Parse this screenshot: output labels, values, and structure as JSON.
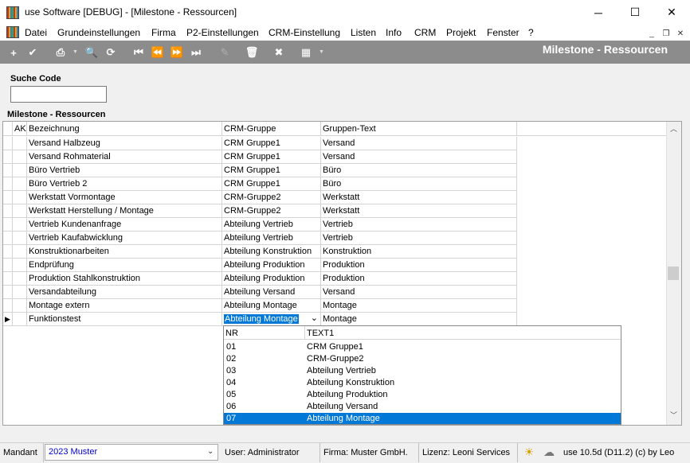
{
  "window": {
    "title": "use Software [DEBUG] - [Milestone - Ressourcen]",
    "min_glyph": "─",
    "max_glyph": "☐",
    "close_glyph": "✕"
  },
  "menu": {
    "items": [
      "Datei",
      "Grundeinstellungen",
      "Firma",
      "P2-Einstellungen",
      "CRM-Einstellung",
      "Listen",
      "Info",
      "CRM",
      "Projekt",
      "Fenster",
      "?"
    ],
    "mdi_min": "_",
    "mdi_restore": "❐",
    "mdi_close": "✕"
  },
  "toolbar": {
    "screen_title": "Milestone - Ressourcen",
    "buttons": [
      {
        "name": "add-icon",
        "glyph": "+"
      },
      {
        "name": "checkmark-icon",
        "glyph": "✔"
      },
      {
        "name": "print-icon",
        "glyph": "⎙"
      },
      {
        "name": "search-icon",
        "glyph": "🔍"
      },
      {
        "name": "refresh-icon",
        "glyph": "⟳"
      },
      {
        "name": "first-record-icon",
        "glyph": "⏮"
      },
      {
        "name": "previous-record-icon",
        "glyph": "⏪"
      },
      {
        "name": "next-record-icon",
        "glyph": "⏩"
      },
      {
        "name": "last-record-icon",
        "glyph": "⏭"
      },
      {
        "name": "edit-icon",
        "glyph": "✎"
      },
      {
        "name": "delete-icon",
        "glyph": "🗑"
      },
      {
        "name": "cancel-icon",
        "glyph": "✖"
      },
      {
        "name": "grid-options-icon",
        "glyph": "▦"
      }
    ]
  },
  "search": {
    "label": "Suche Code",
    "value": ""
  },
  "grid": {
    "title": "Milestone - Ressourcen",
    "headers": {
      "ak": "AK",
      "bezeichnung": "Bezeichnung",
      "crm_gruppe": "CRM-Gruppe",
      "gruppen_text": "Gruppen-Text"
    },
    "rows": [
      {
        "bezeichnung": "Versand Halbzeug",
        "crm_gruppe": "CRM Gruppe1",
        "gruppen_text": "Versand"
      },
      {
        "bezeichnung": "Versand Rohmaterial",
        "crm_gruppe": "CRM Gruppe1",
        "gruppen_text": "Versand"
      },
      {
        "bezeichnung": "Büro Vertrieb",
        "crm_gruppe": "CRM Gruppe1",
        "gruppen_text": "Büro"
      },
      {
        "bezeichnung": "Büro Vertrieb 2",
        "crm_gruppe": "CRM Gruppe1",
        "gruppen_text": "Büro"
      },
      {
        "bezeichnung": "Werkstatt Vormontage",
        "crm_gruppe": "CRM-Gruppe2",
        "gruppen_text": "Werkstatt"
      },
      {
        "bezeichnung": "Werkstatt Herstellung / Montage",
        "crm_gruppe": "CRM-Gruppe2",
        "gruppen_text": "Werkstatt"
      },
      {
        "bezeichnung": "Vertrieb Kundenanfrage",
        "crm_gruppe": "Abteilung Vertrieb",
        "gruppen_text": "Vertrieb"
      },
      {
        "bezeichnung": "Vertrieb Kaufabwicklung",
        "crm_gruppe": "Abteilung Vertrieb",
        "gruppen_text": "Vertrieb"
      },
      {
        "bezeichnung": "Konstruktionarbeiten",
        "crm_gruppe": "Abteilung Konstruktion",
        "gruppen_text": "Konstruktion"
      },
      {
        "bezeichnung": "Endprüfung",
        "crm_gruppe": "Abteilung Produktion",
        "gruppen_text": "Produktion"
      },
      {
        "bezeichnung": "Produktion Stahlkonstruktion",
        "crm_gruppe": "Abteilung Produktion",
        "gruppen_text": "Produktion"
      },
      {
        "bezeichnung": "Versandabteilung",
        "crm_gruppe": "Abteilung Versand",
        "gruppen_text": "Versand"
      },
      {
        "bezeichnung": "Montage extern",
        "crm_gruppe": "Abteilung Montage",
        "gruppen_text": "Montage"
      },
      {
        "bezeichnung": "Funktionstest",
        "crm_gruppe": "Abteilung Montage",
        "gruppen_text": "Montage",
        "current": true,
        "editing": true
      }
    ],
    "current_row_marker": "▶"
  },
  "dropdown": {
    "headers": {
      "nr": "NR",
      "text1": "TEXT1"
    },
    "options": [
      {
        "nr": "01",
        "text1": "CRM Gruppe1"
      },
      {
        "nr": "02",
        "text1": "CRM-Gruppe2"
      },
      {
        "nr": "03",
        "text1": "Abteilung Vertrieb"
      },
      {
        "nr": "04",
        "text1": "Abteilung Konstruktion"
      },
      {
        "nr": "05",
        "text1": "Abteilung Produktion"
      },
      {
        "nr": "06",
        "text1": "Abteilung Versand"
      },
      {
        "nr": "07",
        "text1": "Abteilung Montage",
        "selected": true
      }
    ],
    "caret": "⌄"
  },
  "statusbar": {
    "mandant_label": "Mandant",
    "mandant_value": "2023 Muster",
    "user": "User: Administrator",
    "firma": "Firma: Muster GmbH.",
    "lizenz": "Lizenz: Leoni Services",
    "version": "use 10.5d (D11.2) (c) by Leo",
    "icon_sun": "☀",
    "icon_cloud": "☁"
  },
  "colors": {
    "toolbar_bg": "#8c8c8c",
    "selection": "#0078d7",
    "mandant_text": "#0000cc"
  }
}
